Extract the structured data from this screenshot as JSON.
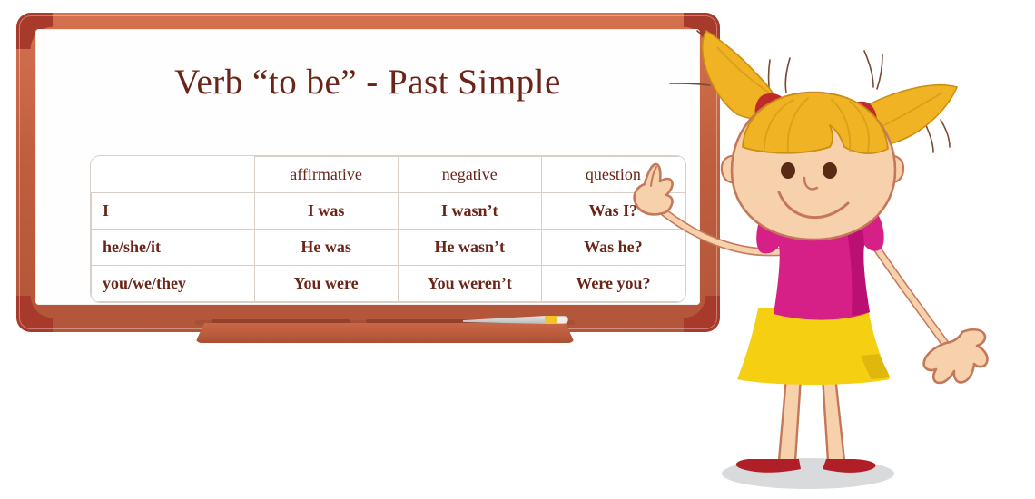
{
  "board": {
    "title": "Verb “to be” - Past Simple",
    "frame_color": "#c05f3f",
    "frame_corner_color": "#a83a2c",
    "surface_color": "#fefefe",
    "title_color": "#6b2418",
    "tray": {
      "name": "marker-tray",
      "pencil": {
        "body_color": "#d0d0d0",
        "band_color": "#f2c32a",
        "eraser_color": "#f3ece4"
      }
    }
  },
  "table": {
    "border_color": "#d8cfc9",
    "text_color": "#6b2418",
    "headers": [
      "",
      "affirmative",
      "negative",
      "question"
    ],
    "rows": [
      {
        "subject": "I",
        "affirmative": "I was",
        "negative": "I wasn’t",
        "question": "Was I?"
      },
      {
        "subject": "he/she/it",
        "affirmative": "He was",
        "negative": "He wasn’t",
        "question": "Was he?"
      },
      {
        "subject": "you/we/they",
        "affirmative": "You were",
        "negative": "You weren’t",
        "question": "Were you?"
      }
    ]
  },
  "character": {
    "name": "girl-pointing-at-board",
    "hair_color": "#f0b323",
    "hair_tie_color": "#c02a2a",
    "skin_color": "#f7d0ac",
    "shirt_color": "#d61f87",
    "skirt_color": "#f5d012",
    "shoe_color": "#b01f28",
    "eye_color": "#5a2a14",
    "outline_color": "#c4785a",
    "shadow_color": "#d9dadb"
  }
}
